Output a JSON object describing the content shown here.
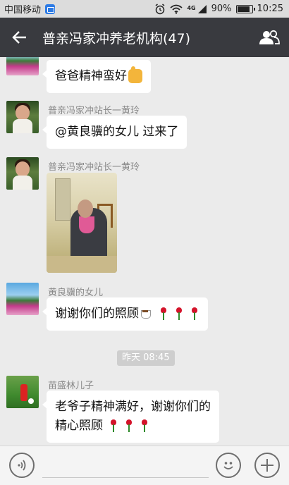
{
  "status_bar": {
    "carrier": "中国移动",
    "network": "4G",
    "battery": "90%",
    "battery_level": 0.9,
    "time": "10:25"
  },
  "header": {
    "title": "普亲冯家冲养老机构(47)"
  },
  "messages": [
    {
      "id": "m1",
      "sender": "",
      "text": "爸爸精神蛮好",
      "emoji": "thumbs-up"
    },
    {
      "id": "m2",
      "sender": "普亲冯家冲站长一黄玲",
      "text": "@黄良骥的女儿 过来了"
    },
    {
      "id": "m3",
      "sender": "普亲冯家冲站长一黄玲",
      "type": "image",
      "image_desc": "elderly-man-photo"
    },
    {
      "id": "m4",
      "sender": "黄良骥的女儿",
      "text": "谢谢你们的照顾",
      "emojis": [
        "coffee",
        "rose",
        "rose",
        "rose"
      ]
    },
    {
      "id": "m5",
      "sender": "苗盛林儿子",
      "text_line1": "老爷子精神满好，谢谢你们的",
      "text_line2": "精心照顾",
      "emojis": [
        "rose",
        "rose",
        "rose"
      ]
    }
  ],
  "time_separator": "昨天 08:45",
  "input_bar": {
    "voice_icon": "voice-icon",
    "emoji_icon": "emoji-icon",
    "plus_icon": "plus-icon"
  },
  "colors": {
    "title_bar": "#393a3f",
    "chat_bg": "#ebebeb",
    "bubble": "#ffffff",
    "sender_name": "#8a8a8a"
  }
}
